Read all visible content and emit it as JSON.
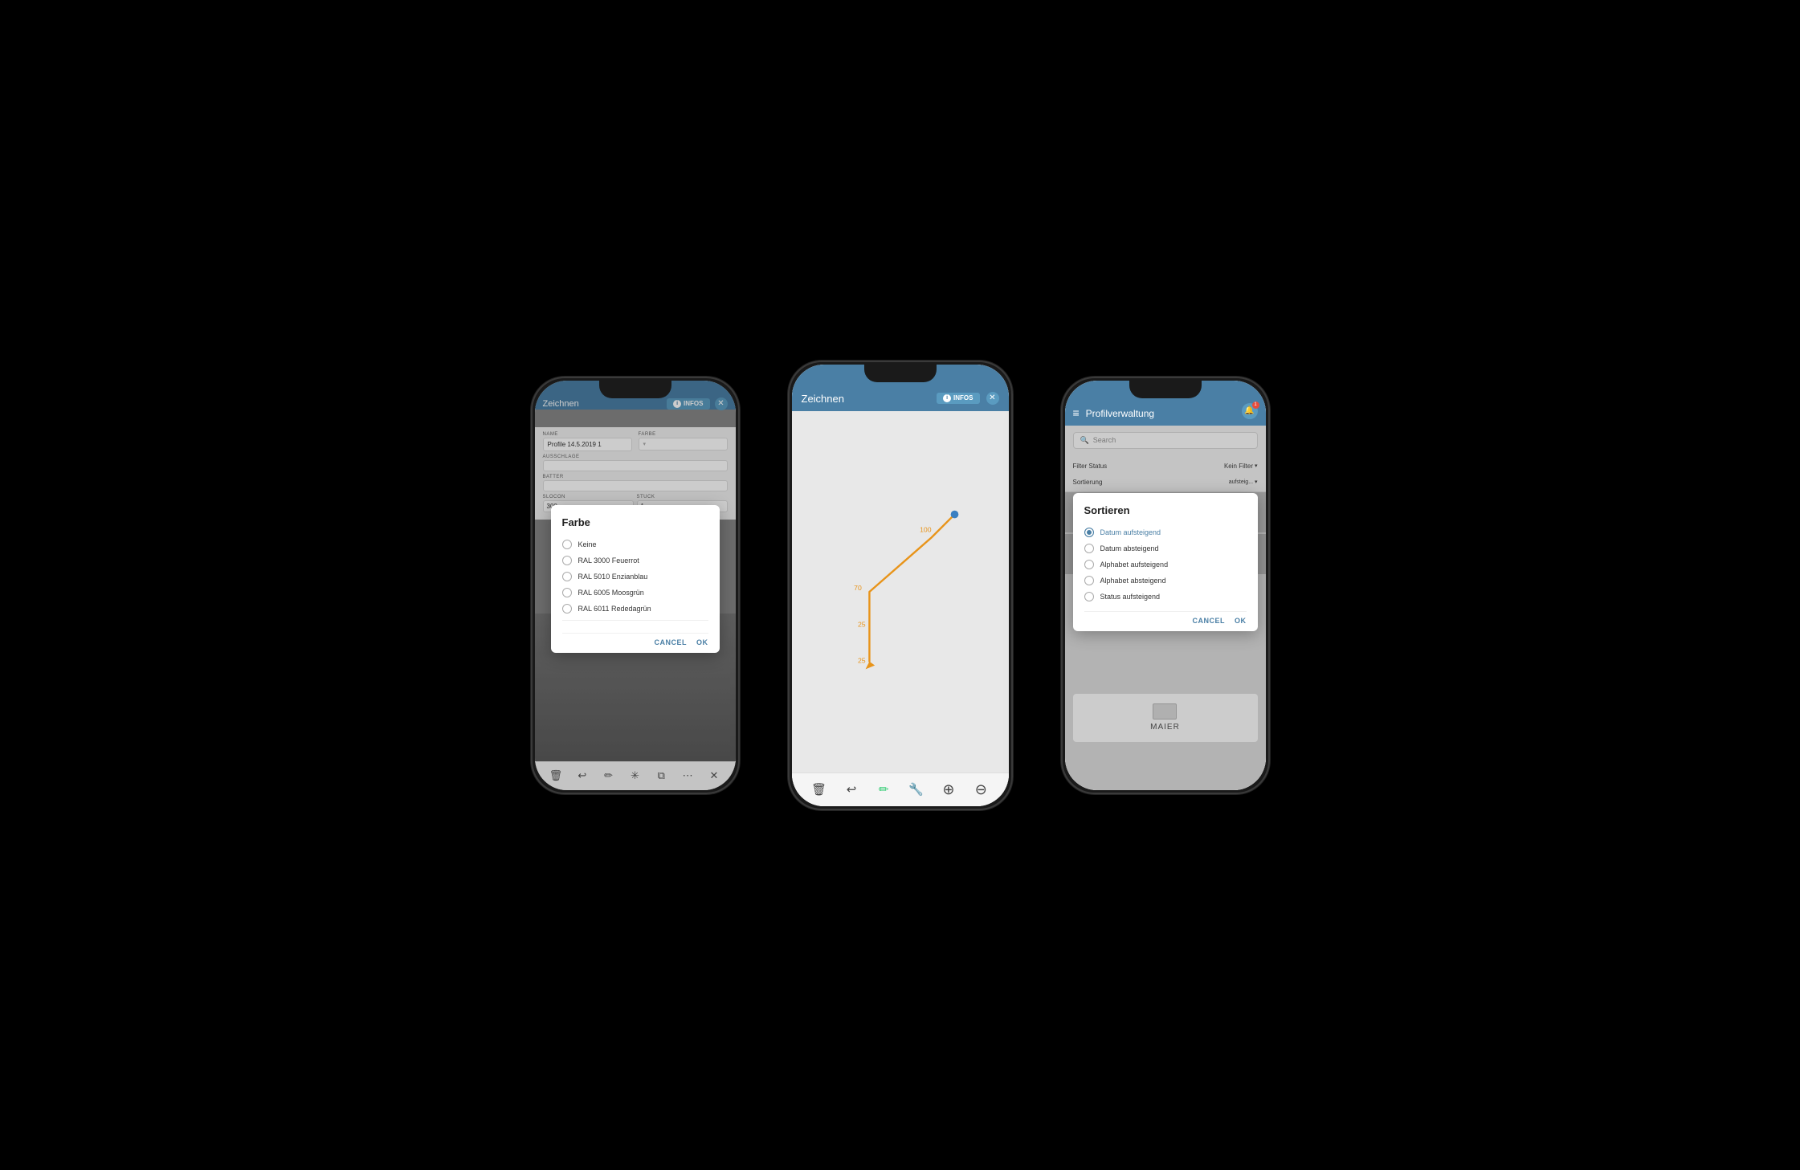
{
  "background": "#000000",
  "phone1": {
    "header": {
      "title": "Zeichnen",
      "infos_label": "INFOS"
    },
    "form": {
      "name_label": "NAME",
      "name_value": "Profile 14.5.2019 1",
      "farbe_label": "FARBE",
      "ausschlage_label": "AUSSCHLAGE",
      "batter_label": "BATTER",
      "slocon_label": "SLOCON",
      "slocon_value": "300",
      "stuck_label": "STUCK",
      "stuck_value": "1"
    },
    "farbe_dialog": {
      "title": "Farbe",
      "options": [
        {
          "label": "Keine",
          "selected": false
        },
        {
          "label": "RAL 3000 Feuerrot",
          "selected": false
        },
        {
          "label": "RAL 5010 Enzianblau",
          "selected": false
        },
        {
          "label": "RAL 6005 Moosgrün",
          "selected": false
        },
        {
          "label": "RAL 6011 Rededagrün",
          "selected": false
        }
      ],
      "cancel_label": "CANCEL",
      "ok_label": "OK"
    }
  },
  "phone2": {
    "header": {
      "title": "Zeichnen",
      "infos_label": "INFOS"
    },
    "drawing": {
      "label1": "100",
      "label2": "70",
      "label3": "25",
      "label4": "25"
    }
  },
  "phone3": {
    "header": {
      "title": "Profilverwaltung",
      "notification_count": "1"
    },
    "search": {
      "placeholder": "Search"
    },
    "filter": {
      "label": "Filter Status",
      "value": "Kein Filter"
    },
    "sort": {
      "label": "Sortierung"
    },
    "maier_label": "MAIER",
    "sortieren_dialog": {
      "title": "Sortieren",
      "options": [
        {
          "label": "Datum aufsteigend",
          "selected": true
        },
        {
          "label": "Datum absteigend",
          "selected": false
        },
        {
          "label": "Alphabet aufsteigend",
          "selected": false
        },
        {
          "label": "Alphabet absteigend",
          "selected": false
        },
        {
          "label": "Status aufsteigend",
          "selected": false
        }
      ],
      "cancel_label": "CANCEL",
      "ok_label": "OK"
    }
  }
}
